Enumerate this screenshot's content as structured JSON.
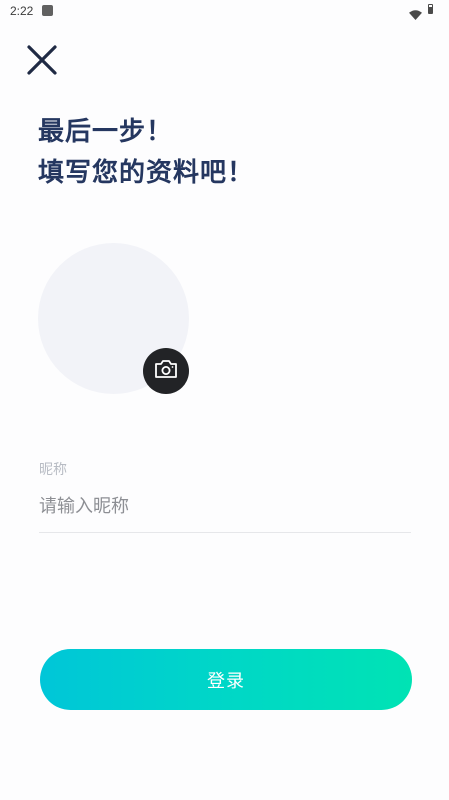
{
  "status_bar": {
    "time": "2:22",
    "app_icon": "notification-app-icon",
    "wifi_icon": "wifi-icon",
    "battery_icon": "battery-icon"
  },
  "header": {
    "close_icon": "close-icon"
  },
  "title": {
    "line1": "最后一步！",
    "line2": "填写您的资料吧！"
  },
  "avatar": {
    "camera_icon": "camera-icon"
  },
  "form": {
    "nickname_label": "昵称",
    "nickname_placeholder": "请输入昵称",
    "nickname_value": ""
  },
  "actions": {
    "login_label": "登录"
  },
  "colors": {
    "title": "#253760",
    "avatar_bg": "#f2f3f8",
    "camera_bg": "#222326",
    "button_gradient_start": "#00c6d8",
    "button_gradient_end": "#00e3b4"
  }
}
